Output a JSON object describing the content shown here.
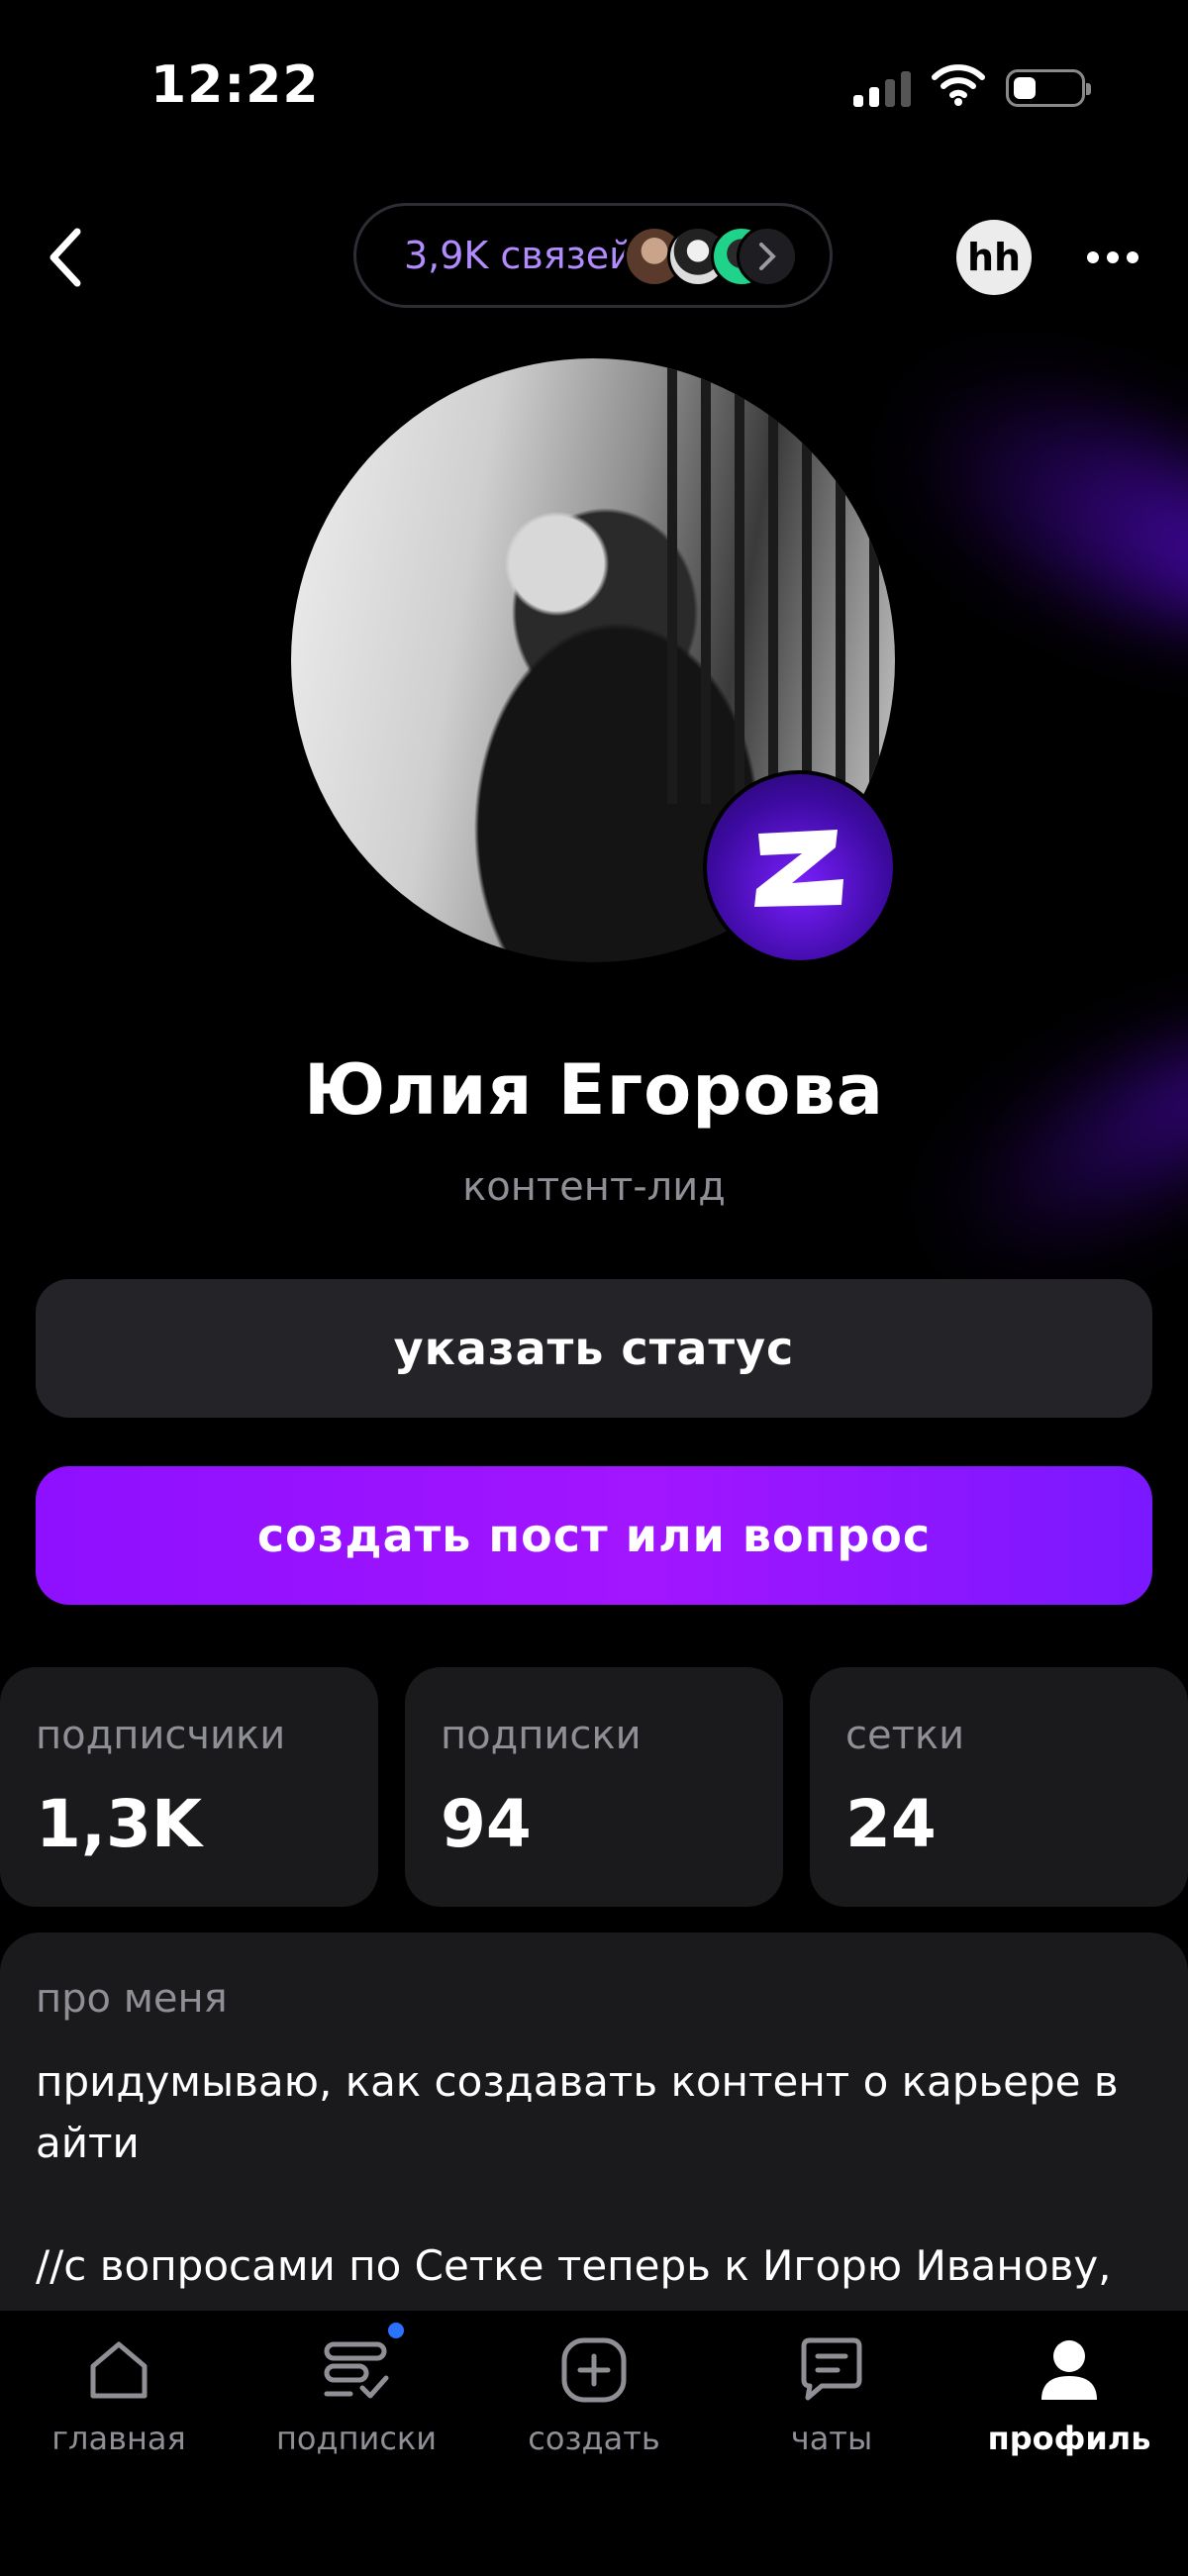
{
  "status_bar": {
    "time": "12:22"
  },
  "header": {
    "connections_label": "3,9K связей",
    "hh_label": "hh"
  },
  "profile": {
    "name": "Юлия Егорова",
    "role": "контент-лид"
  },
  "actions": {
    "status_button": "указать статус",
    "create_button": "создать пост или вопрос"
  },
  "stats": [
    {
      "label": "подписчики",
      "value": "1,3K"
    },
    {
      "label": "подписки",
      "value": "94"
    },
    {
      "label": "сетки",
      "value": "24"
    }
  ],
  "about": {
    "label": "про меня",
    "text": "придумываю, как создавать контент о карьере в айти\n\n//с вопросами по Сетке теперь к Игорю Иванову, а я"
  },
  "nav": [
    {
      "label": "главная",
      "icon": "home-icon"
    },
    {
      "label": "подписки",
      "icon": "subscriptions-icon"
    },
    {
      "label": "создать",
      "icon": "plus-square-icon"
    },
    {
      "label": "чаты",
      "icon": "chat-icon"
    },
    {
      "label": "профиль",
      "icon": "profile-icon"
    }
  ],
  "colors": {
    "accent": "#9b16ff",
    "connections_text": "#b28cff",
    "nav_dot": "#2a73ff"
  }
}
